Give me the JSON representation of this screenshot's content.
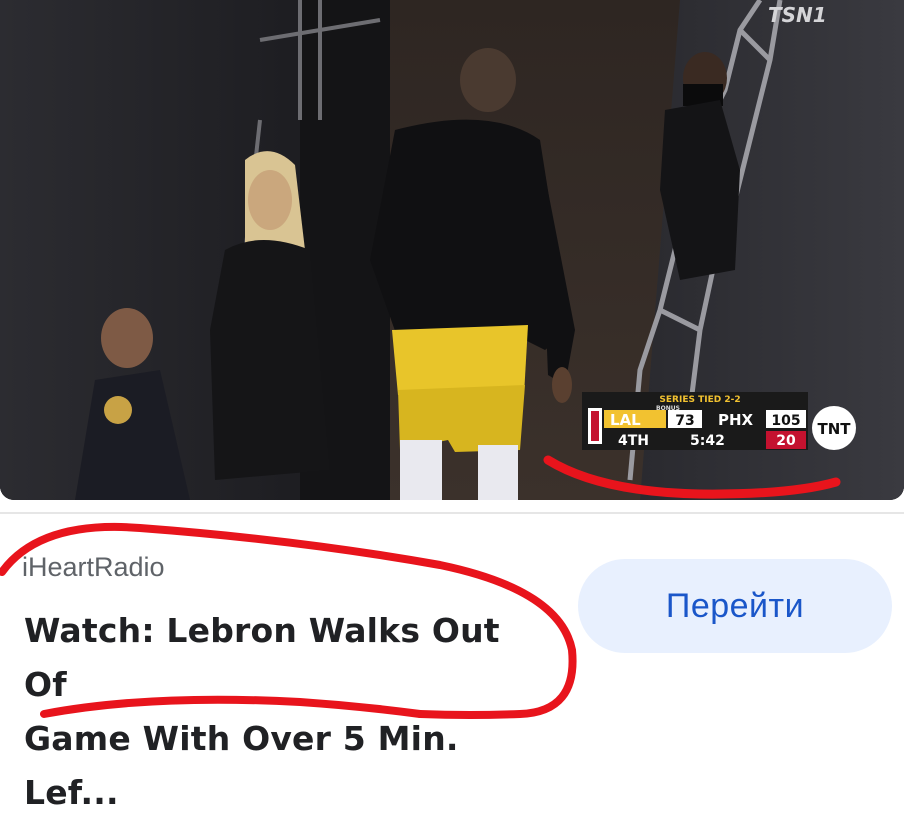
{
  "video": {
    "channel_logo": "TSN1",
    "broadcaster": "TNT",
    "scoreboard": {
      "series": "SERIES TIED 2-2",
      "bonus": "BONUS",
      "team1": "LAL",
      "score1": "73",
      "team2": "PHX",
      "score2": "105",
      "period": "4TH",
      "clock": "5:42",
      "shot_clock": "20"
    }
  },
  "result": {
    "source": "iHeartRadio",
    "title_line1": "Watch: Lebron Walks Out Of",
    "title_line2": "Game With Over 5 Min. Lef..."
  },
  "actions": {
    "go_label": "Перейти"
  },
  "colors": {
    "button_bg": "#e8f0fe",
    "button_text": "#1a56c9",
    "annotation": "#e8141c",
    "lakers_gold": "#f2c230",
    "shot_clock_red": "#c4122f"
  }
}
